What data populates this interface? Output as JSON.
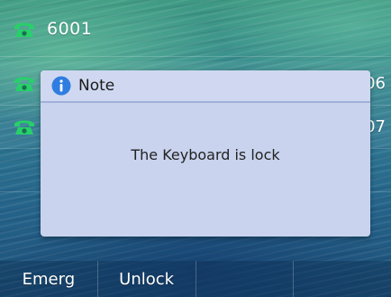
{
  "lines": [
    {
      "label": "6001",
      "icon": "phone-icon"
    },
    {
      "label": "",
      "icon": "phone-icon",
      "tail": "06"
    },
    {
      "label": "",
      "icon": "phone-icon",
      "tail": "07"
    }
  ],
  "dialog": {
    "title": "Note",
    "message": "The Keyboard is lock",
    "icon": "info-icon"
  },
  "softkeys": [
    "Emerg",
    "Unlock",
    "",
    ""
  ],
  "colors": {
    "phone_icon": "#27d06a",
    "info_icon": "#2f7de1",
    "dialog_bg": "#c9d3ee"
  }
}
